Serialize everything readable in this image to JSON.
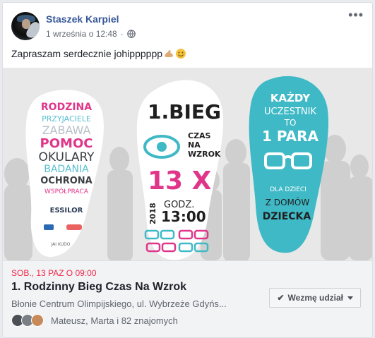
{
  "post": {
    "author": "Staszek Karpiel",
    "time": "1 września o 12:48",
    "dot": "·",
    "text": "Zapraszam serdecznie johipppppp",
    "more_label": "•••"
  },
  "poster": {
    "left_words": [
      "RODZINA",
      "PRZYJACIELE",
      "ZABAWA",
      "POMOC",
      "OKULARY",
      "BADANIA",
      "OCHRONA",
      "WSPÓŁPRACA"
    ],
    "left_sponsor": "ESSILOR",
    "left_small": "JAI KUDO",
    "title_line1": "1.BIEG",
    "title_line2a": "CZAS",
    "title_line2b": "NA",
    "title_line2c": "WZROK",
    "repeat": "13 X",
    "year": "2018",
    "hour_label": "GODZ.",
    "hour": "13:00",
    "right_line1": "KAŻDY",
    "right_line2": "UCZESTNIK",
    "right_line3": "TO",
    "right_line4": "1 PARA",
    "right_line5": "DLA DZIECI",
    "right_line6": "Z DOMÓW",
    "right_line7": "DZIECKA"
  },
  "event": {
    "date": "SOB., 13 PAZ O 09:00",
    "title": "1. Rodzinny Bieg Czas Na Wzrok",
    "place": "Błonie Centrum Olimpijskiego, ul. Wybrzeże Gdyńs...",
    "friends": "Mateusz, Marta i 82 znajomych",
    "going_label": "Wezmę udział",
    "accent": "#f02849"
  }
}
